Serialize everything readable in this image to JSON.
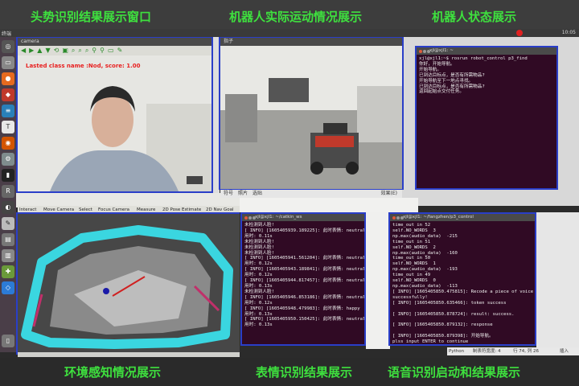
{
  "annotations": {
    "head": "头势识别结果展示窗口",
    "robot": "机器人实际运动情况展示",
    "state": "机器人状态展示",
    "env": "环境感知情况展示",
    "emotion": "表情识别结果展示",
    "voice": "语音识别启动和结果展示"
  },
  "sysbar": {
    "title": "终端",
    "time": "10:05"
  },
  "camera": {
    "title": "camera",
    "label": "Lasted class name :Nod, score: 1.00"
  },
  "robot": {
    "title": "指子",
    "bottom_tabs": [
      "符号",
      "照片",
      "选贴"
    ],
    "bottom_right": "效果(E)"
  },
  "state_term": {
    "title": "xjl@xjl1: ~",
    "text": "xjl@xjl1:~$ rosrun robot_control p3_find\n你好，开始导航。\n开始导航。\n已到达目标点，是否有所需物品?\n开始导航至下一地点寻找。\n已到达目标点，是否有所需物品?\n返回起始点交付任务。"
  },
  "emotion_term": {
    "title": "xjl@xjl1: ~/catkin_ws",
    "text": "未检测到人脸!\n[ INFO] [1605405939.189225]: 此时表情: neutral\n用时: 0.11s\n未检测到人脸!\n未检测到人脸!\n未检测到人脸!\n[ INFO] [1605405941.561204]: 此时表情: neutral\n用时: 0.12s\n[ INFO] [1605405943.189841]: 此时表情: neutral\n用时: 0.12s\n[ INFO] [1605405944.817457]: 此时表情: neutral\n用时: 0.13s\n未检测到人脸!\n[ INFO] [1605405946.853186]: 此时表情: neutral\n用时: 0.12s\n[ INFO] [1605405948.479983]: 此时表情: happy\n用时: 0.13s\n[ INFO] [1605405950.150425]: 此时表情: neutral\n用时: 0.13s"
  },
  "voice_term": {
    "title": "xjl@xjl1: ~/fangzhen/p3_control",
    "text": "time_out in 52\nself.NO_WORDS  3\nnp.max(audio_data)  -215\ntime_out in 51\nself.NO_WORDS  2\nnp.max(audio_data)  -160\ntime_out in 50\nself.NO_WORDS  1\nnp.max(audio_data)  -193\ntime_out in 49\nself.NO_WORDS  0\nnp.max(audio_data)  -113\n[ INFO] [1605405850.475815]: Recode a piece of voice\nsuccessfully!\n[ INFO] [1605405850.635466]: token success\n\n[ INFO] [1605405850.878724]: result: success.\n\n[ INFO] [1605405850.879132]: response\n\n[ INFO] [1605405850.879398]: 开始导航。\nplss input ENTER to continue"
  },
  "map_tool": {
    "items": [
      "Interact",
      "Move Camera",
      "Select",
      "Focus Camera",
      "Measure",
      "2D Pose Estimate",
      "2D Nav Goal"
    ]
  },
  "gedit": {
    "lang": "Python",
    "tab": "制表符宽度: 4",
    "pos": "行 74, 列 26",
    "ins": "插入"
  },
  "colors": {
    "annot": "#3ee03e",
    "frame": "#2a3ec8",
    "terminal": "#300a24"
  }
}
